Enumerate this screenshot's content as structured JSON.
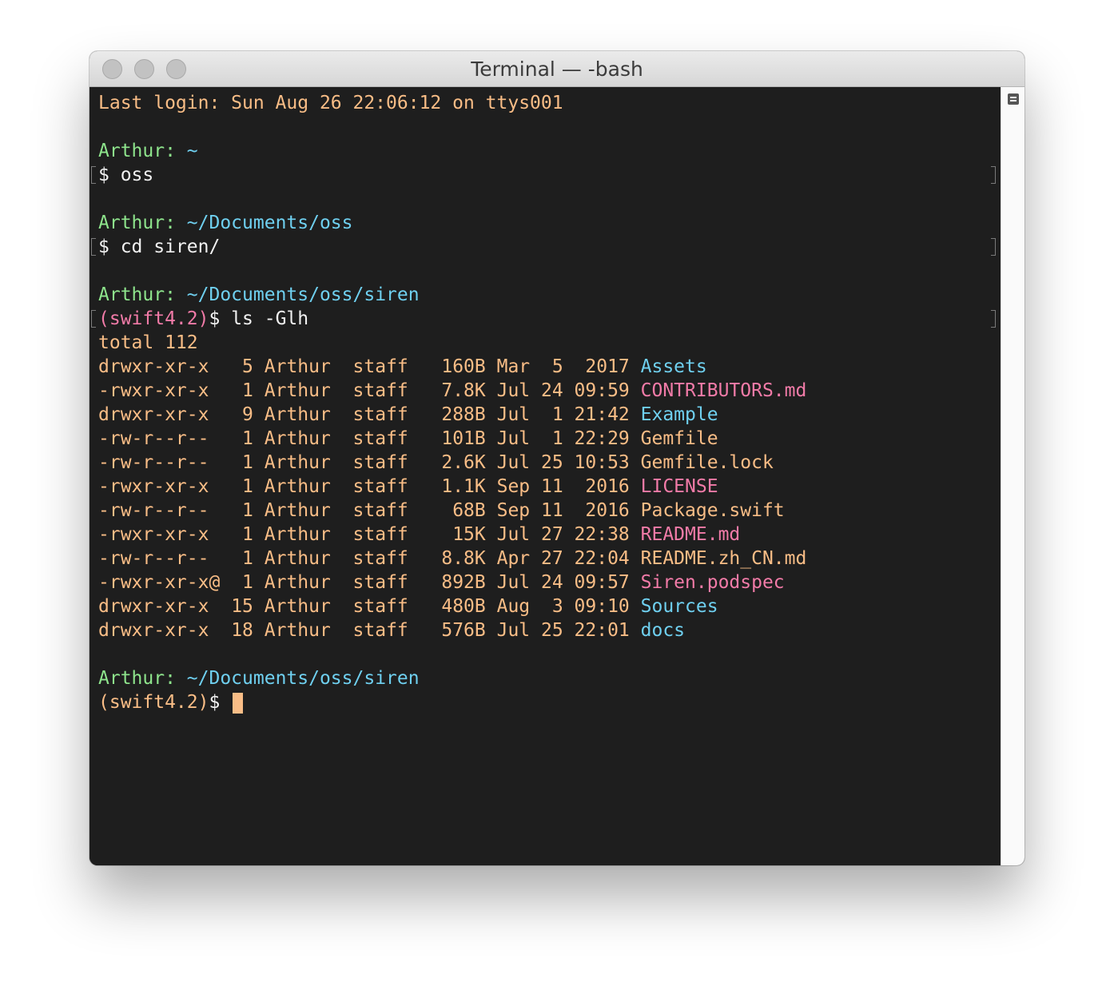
{
  "window": {
    "title": "Terminal — -bash"
  },
  "terminal": {
    "last_login": "Last login: Sun Aug 26 22:06:12 on ttys001",
    "blocks": [
      {
        "user": "Arthur:",
        "path": "~",
        "venv": "",
        "prompt": "$ ",
        "command": "oss"
      },
      {
        "user": "Arthur:",
        "path": "~/Documents/oss",
        "venv": "",
        "prompt": "$ ",
        "command": "cd siren/"
      },
      {
        "user": "Arthur:",
        "path": "~/Documents/oss/siren",
        "venv": "(swift4.2)",
        "prompt": "$ ",
        "command": "ls -Glh"
      }
    ],
    "total": "total 112",
    "listing": [
      {
        "perms": "drwxr-xr-x ",
        "links": " 5",
        "owner": "Arthur",
        "group": "staff",
        "size": " 160B",
        "date": "Mar  5  2017",
        "name": "Assets",
        "kind": "dir"
      },
      {
        "perms": "-rwxr-xr-x ",
        "links": " 1",
        "owner": "Arthur",
        "group": "staff",
        "size": " 7.8K",
        "date": "Jul 24 09:59",
        "name": "CONTRIBUTORS.md",
        "kind": "exec"
      },
      {
        "perms": "drwxr-xr-x ",
        "links": " 9",
        "owner": "Arthur",
        "group": "staff",
        "size": " 288B",
        "date": "Jul  1 21:42",
        "name": "Example",
        "kind": "dir"
      },
      {
        "perms": "-rw-r--r-- ",
        "links": " 1",
        "owner": "Arthur",
        "group": "staff",
        "size": " 101B",
        "date": "Jul  1 22:29",
        "name": "Gemfile",
        "kind": "file"
      },
      {
        "perms": "-rw-r--r-- ",
        "links": " 1",
        "owner": "Arthur",
        "group": "staff",
        "size": " 2.6K",
        "date": "Jul 25 10:53",
        "name": "Gemfile.lock",
        "kind": "file"
      },
      {
        "perms": "-rwxr-xr-x ",
        "links": " 1",
        "owner": "Arthur",
        "group": "staff",
        "size": " 1.1K",
        "date": "Sep 11  2016",
        "name": "LICENSE",
        "kind": "exec"
      },
      {
        "perms": "-rw-r--r-- ",
        "links": " 1",
        "owner": "Arthur",
        "group": "staff",
        "size": "  68B",
        "date": "Sep 11  2016",
        "name": "Package.swift",
        "kind": "file"
      },
      {
        "perms": "-rwxr-xr-x ",
        "links": " 1",
        "owner": "Arthur",
        "group": "staff",
        "size": "  15K",
        "date": "Jul 27 22:38",
        "name": "README.md",
        "kind": "exec"
      },
      {
        "perms": "-rw-r--r-- ",
        "links": " 1",
        "owner": "Arthur",
        "group": "staff",
        "size": " 8.8K",
        "date": "Apr 27 22:04",
        "name": "README.zh_CN.md",
        "kind": "file"
      },
      {
        "perms": "-rwxr-xr-x@",
        "links": " 1",
        "owner": "Arthur",
        "group": "staff",
        "size": " 892B",
        "date": "Jul 24 09:57",
        "name": "Siren.podspec",
        "kind": "exec"
      },
      {
        "perms": "drwxr-xr-x ",
        "links": "15",
        "owner": "Arthur",
        "group": "staff",
        "size": " 480B",
        "date": "Aug  3 09:10",
        "name": "Sources",
        "kind": "dir"
      },
      {
        "perms": "drwxr-xr-x ",
        "links": "18",
        "owner": "Arthur",
        "group": "staff",
        "size": " 576B",
        "date": "Jul 25 22:01",
        "name": "docs",
        "kind": "dir"
      }
    ],
    "final_prompt": {
      "user": "Arthur:",
      "path": "~/Documents/oss/siren",
      "venv": "(swift4.2)",
      "prompt": "$ "
    },
    "colors": {
      "background": "#1e1e1e",
      "text": "#f9bd86",
      "user": "#8ee48c",
      "path": "#6fd0f0",
      "directory": "#6fd0f0",
      "executable": "#f27ba8",
      "venv": "#f27ba8",
      "cursor": "#f9bd86"
    }
  }
}
